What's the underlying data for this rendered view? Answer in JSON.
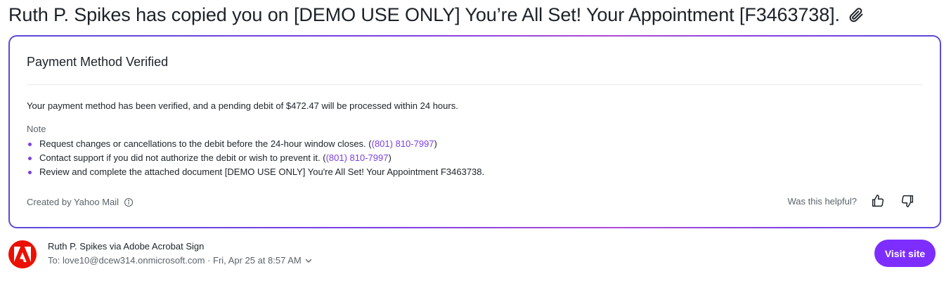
{
  "message": {
    "subject": "Ruth P. Spikes has copied you on [DEMO USE ONLY] You’re All Set! Your Appointment [F3463738].",
    "attachment_icon": "paperclip-icon"
  },
  "summary": {
    "title": "Payment Method Verified",
    "body": "Your payment method has been verified, and a pending debit of $472.47 will be processed within 24 hours.",
    "note_label": "Note",
    "notes": [
      {
        "text": "Request changes or cancellations to the debit before the 24-hour window closes. (",
        "link": "(801) 810-7997",
        "suffix": ")"
      },
      {
        "text": "Contact support if you did not authorize the debit or wish to prevent it. (",
        "link": "(801) 810-7997",
        "suffix": ")"
      },
      {
        "text": "Review and complete the attached document [DEMO USE ONLY] You're All Set! Your Appointment F3463738.",
        "link": "",
        "suffix": ""
      }
    ],
    "created_by": "Created by Yahoo Mail",
    "helpful_prompt": "Was this helpful?",
    "accent_color": "#7b3fe4"
  },
  "sender": {
    "name": "Ruth P. Spikes via Adobe Acrobat Sign",
    "recipient_line": "To:  love10@dcew314.onmicrosoft.com · Fri, Apr 25 at 8:57 AM",
    "avatar_color": "#eb1000",
    "visit_label": "Visit site",
    "visit_color": "#7d2eff"
  }
}
